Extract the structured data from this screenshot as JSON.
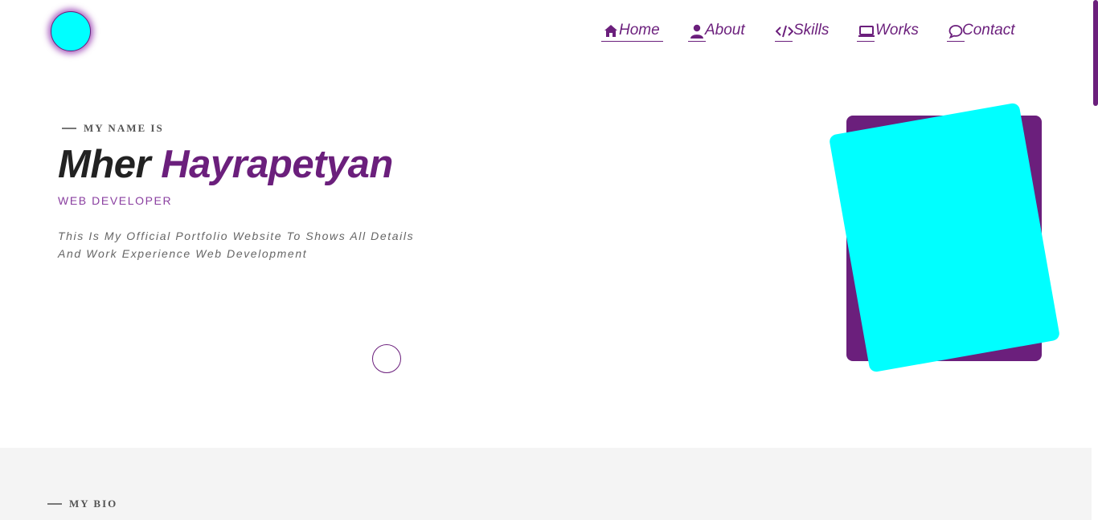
{
  "nav": {
    "items": [
      {
        "label": "Home",
        "icon": "home-icon",
        "active": true
      },
      {
        "label": "About",
        "icon": "user-icon"
      },
      {
        "label": "Skills",
        "icon": "code-icon"
      },
      {
        "label": "Works",
        "icon": "laptop-icon"
      },
      {
        "label": "Contact",
        "icon": "chat-icon"
      }
    ]
  },
  "hero": {
    "kicker": "MY NAME IS",
    "first_name": "Mher",
    "last_name": "Hayrapetyan",
    "role": "WEB DEVELOPER",
    "description_line1": "This Is My Official Portfolio Website To Shows All Details",
    "description_line2": "And Work Experience Web Development"
  },
  "bio": {
    "kicker": "MY BIO"
  },
  "colors": {
    "accent": "#6b1f7c",
    "highlight": "#00ffff",
    "text_dark": "#222222",
    "section_bg": "#f4f4f4"
  }
}
